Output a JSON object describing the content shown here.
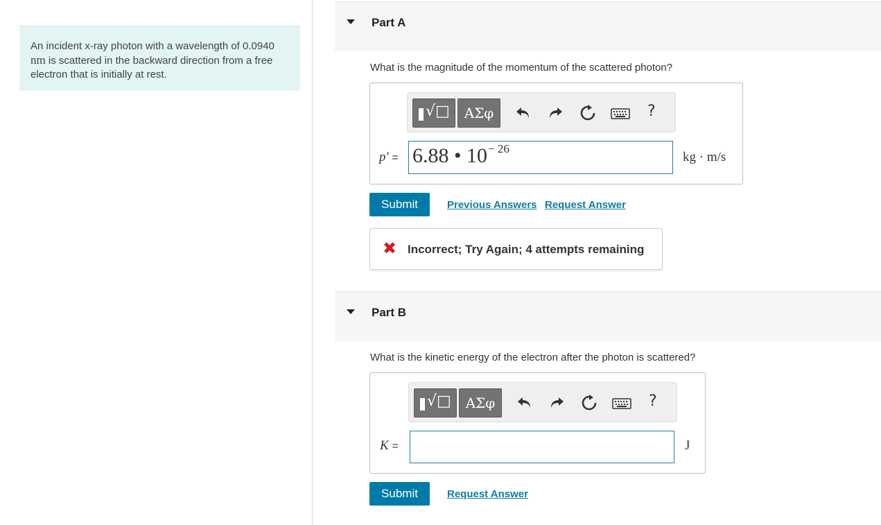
{
  "problem": {
    "text_before_unit": "An incident x-ray photon with a wavelength of 0.0940 ",
    "unit": "nm",
    "text_after_unit": " is scattered in the backward direction from a free electron that is initially at rest."
  },
  "part_a": {
    "title": "Part A",
    "question": "What is the magnitude of the momentum of the scattered photon?",
    "toolbar": {
      "templates_symbol": "√□",
      "greek_label": "ΑΣφ",
      "help_label": "?"
    },
    "variable": "p′",
    "equals": "=",
    "answer_mantissa": "6.88 • 10",
    "answer_exponent": "− 26",
    "units": "kg · m/s",
    "submit_label": "Submit",
    "previous_answers_label": "Previous Answers",
    "request_answer_label": "Request Answer",
    "feedback_icon": "✖",
    "feedback_message": "Incorrect; Try Again; 4 attempts remaining"
  },
  "part_b": {
    "title": "Part B",
    "question": "What is the kinetic energy of the electron after the photon is scattered?",
    "toolbar": {
      "templates_symbol": "√□",
      "greek_label": "ΑΣφ",
      "help_label": "?"
    },
    "variable": "K",
    "equals": "=",
    "answer_value": "",
    "units": "J",
    "submit_label": "Submit",
    "request_answer_label": "Request Answer"
  },
  "colors": {
    "accent": "#007ba7",
    "link": "#0e7ea7",
    "error": "#d21d1d",
    "problem_bg": "#e3f4f4"
  },
  "icons": [
    "undo-icon",
    "redo-icon",
    "reset-icon",
    "keyboard-icon",
    "close-x-icon",
    "caret-down-icon"
  ]
}
